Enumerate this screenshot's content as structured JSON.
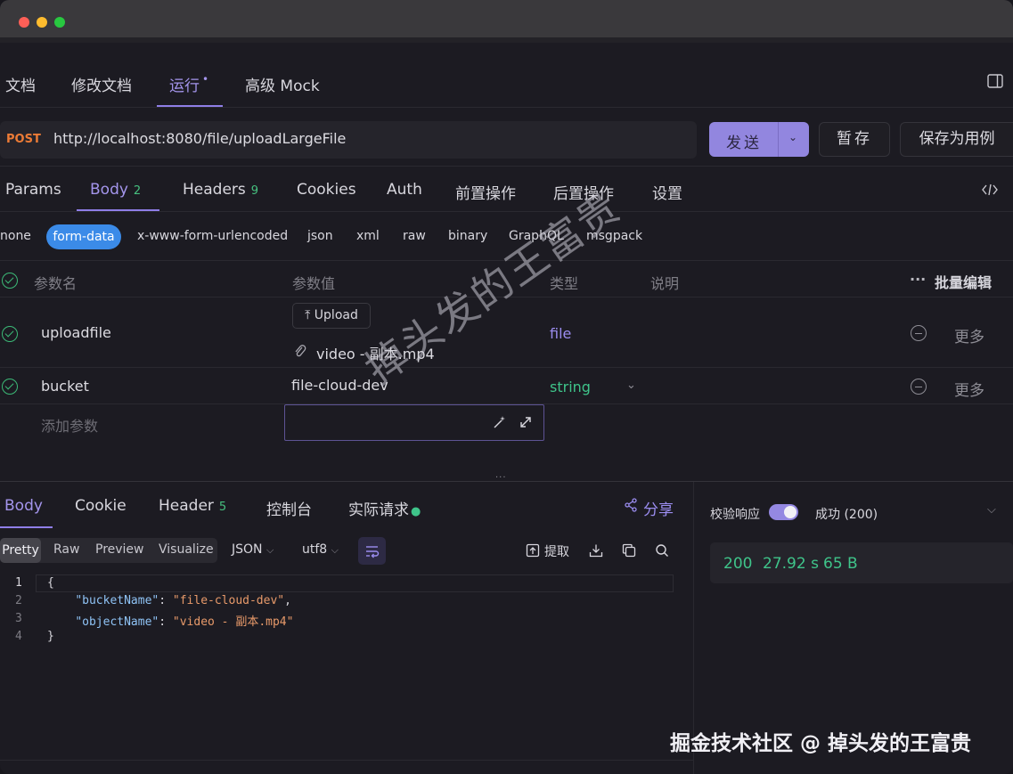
{
  "window": {
    "traffic_colors": [
      "#fe5f57",
      "#febc2e",
      "#28c840"
    ]
  },
  "subtabs": [
    {
      "label": "文档"
    },
    {
      "label": "修改文档"
    },
    {
      "label": "运行",
      "active": true
    },
    {
      "label": "高级 Mock"
    }
  ],
  "request": {
    "method": "POST",
    "url": "http://localhost:8080/file/uploadLargeFile",
    "send_label": "发送",
    "save_label": "暂存",
    "save_case_label": "保存为用例"
  },
  "request_tabs": {
    "params": "Params",
    "body": "Body",
    "body_count": "2",
    "headers": "Headers",
    "headers_count": "9",
    "cookies": "Cookies",
    "auth": "Auth",
    "pre": "前置操作",
    "post": "后置操作",
    "settings": "设置"
  },
  "body_types": {
    "none": "none",
    "form_data": "form-data",
    "urlencoded": "x-www-form-urlencoded",
    "json": "json",
    "xml": "xml",
    "raw": "raw",
    "binary": "binary",
    "graphql": "GraphQL",
    "msgpack": "msgpack"
  },
  "table": {
    "col_name": "参数名",
    "col_value": "参数值",
    "col_type": "类型",
    "col_desc": "说明",
    "bulk_edit": "批量编辑",
    "rows": [
      {
        "name": "uploadfile",
        "upload_label": "Upload",
        "file": "video - 副本.mp4",
        "type": "file",
        "more": "更多"
      },
      {
        "name": "bucket",
        "value": "file-cloud-dev",
        "type": "string",
        "more": "更多"
      }
    ],
    "add_param": "添加参数"
  },
  "response_tabs": {
    "body": "Body",
    "cookie": "Cookie",
    "header": "Header",
    "header_count": "5",
    "console": "控制台",
    "actual": "实际请求",
    "share": "分享"
  },
  "response_toolbar": {
    "pretty": "Pretty",
    "raw": "Raw",
    "preview": "Preview",
    "visualize": "Visualize",
    "lang": "JSON",
    "encoding": "utf8",
    "extract": "提取"
  },
  "response_body": {
    "lines": [
      "1",
      "2",
      "3",
      "4"
    ],
    "open": "{",
    "k1": "\"bucketName\"",
    "v1": "\"file-cloud-dev\"",
    "k2": "\"objectName\"",
    "v2": "\"video - 副本.mp4\"",
    "close": "}"
  },
  "response_meta": {
    "validate_label": "校验响应",
    "result": "成功 (200)",
    "status": "200",
    "time": "27.92 s",
    "size": "65 B"
  },
  "watermark": "掉头发的王富贵",
  "footer": "掘金技术社区 @ 掉头发的王富贵",
  "colors": {
    "accent": "#9286df",
    "method": "#ec7b36",
    "success": "#3fc48a",
    "form_data": "#3b8be8"
  }
}
